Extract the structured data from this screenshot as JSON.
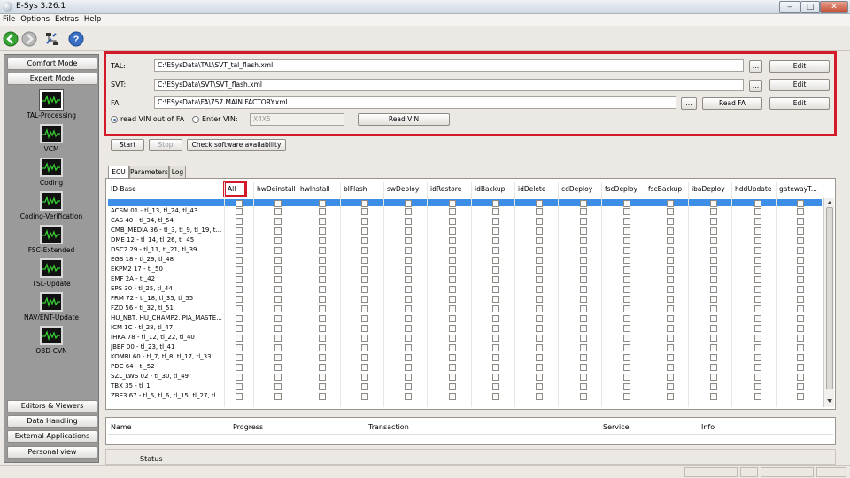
{
  "window": {
    "title": "E-Sys 3.26.1",
    "controls": {
      "minimize": "‒",
      "maximize": "□",
      "close": "✕"
    }
  },
  "menu": [
    "File",
    "Options",
    "Extras",
    "Help"
  ],
  "toolbar": {
    "icons": [
      "back-icon",
      "forward-icon",
      "connection-icon",
      "help-icon"
    ]
  },
  "sidebar": {
    "top_buttons": [
      "Comfort Mode",
      "Expert Mode"
    ],
    "nav_items": [
      "TAL-Processing",
      "VCM",
      "Coding",
      "Coding-Verification",
      "FSC-Extended",
      "TSL-Update",
      "NAV/ENT-Update",
      "OBD-CVN"
    ],
    "selected": "TAL-Processing",
    "bottom_buttons": [
      "Editors & Viewers",
      "Data Handling",
      "External Applications",
      "Personal view"
    ]
  },
  "files": {
    "tal": {
      "label": "TAL:",
      "value": "C:\\ESysData\\TAL\\SVT_tal_flash.xml",
      "browse": "...",
      "edit": "Edit"
    },
    "svt": {
      "label": "SVT:",
      "value": "C:\\ESysData\\SVT\\SVT_flash.xml",
      "browse": "...",
      "edit": "Edit"
    },
    "fa": {
      "label": "FA:",
      "value": "C:\\ESysData\\FA\\757 MAIN FACTORY.xml",
      "browse": "...",
      "read": "Read FA",
      "edit": "Edit"
    },
    "vin": {
      "opt_read": "read VIN out of FA",
      "opt_enter": "Enter VIN:",
      "vin_value": "X4X5",
      "read_vin": "Read VIN"
    }
  },
  "actions": {
    "start": "Start",
    "stop": "Stop",
    "check": "Check software availability"
  },
  "tabs": [
    "ECU",
    "Parameters",
    "Log"
  ],
  "ecu_table": {
    "columns": [
      "ID-Base",
      "All",
      "hwDeinstall",
      "hwInstall",
      "blFlash",
      "swDeploy",
      "idRestore",
      "idBackup",
      "idDelete",
      "cdDeploy",
      "fscDeploy",
      "fscBackup",
      "ibaDeploy",
      "hddUpdate",
      "gatewayT..."
    ],
    "rows": [
      "ACSM 01 - tl_13, tl_24, tl_43",
      "CAS 40 - tl_34, tl_54",
      "CMB_MEDIA 36 - tl_3, tl_9, tl_19, t...",
      "DME 12 - tl_14, tl_26, tl_45",
      "DSC2 29 - tl_11, tl_21, tl_39",
      "EGS 18 - tl_29, tl_48",
      "EKPM2 17 - tl_50",
      "EMF 2A - tl_42",
      "EPS 30 - tl_25, tl_44",
      "FRM 72 - tl_18, tl_35, tl_55",
      "FZD 56 - tl_32, tl_51",
      "HU_NBT, HU_CHAMP2, PIA_MASTE...",
      "ICM 1C - tl_28, tl_47",
      "IHKA 78 - tl_12, tl_22, tl_40",
      "JBBF 00 - tl_23, tl_41",
      "KOMBI 60 - tl_7, tl_8, tl_17, tl_33, ...",
      "PDC 64 - tl_52",
      "SZL_LWS 02 - tl_30, tl_49",
      "TBX 35 - tl_1",
      "ZBE3 67 - tl_5, tl_6, tl_15, tl_27, tl..."
    ]
  },
  "bottom_table": {
    "columns": [
      "Name",
      "Progress",
      "Transaction",
      "Service",
      "Info"
    ]
  },
  "status": {
    "label": "Status"
  },
  "colors": {
    "highlight": "#d21a2a",
    "selection": "#3d8ee6"
  }
}
